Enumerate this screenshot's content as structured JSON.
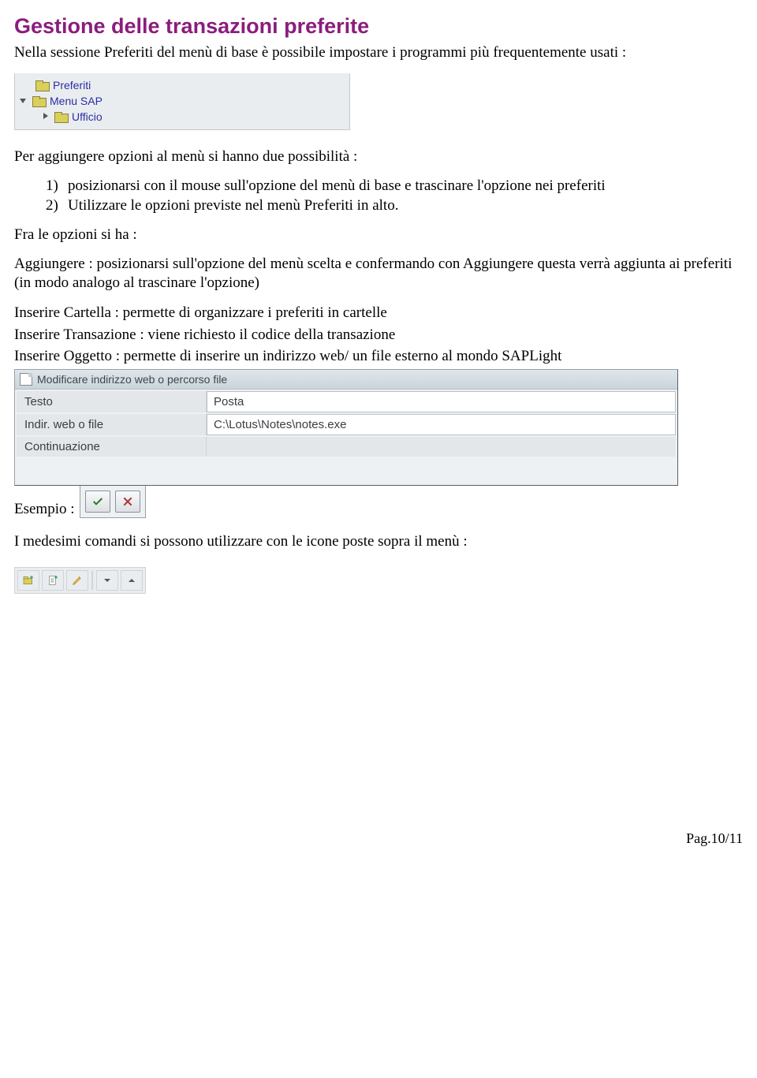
{
  "heading": "Gestione delle transazioni preferite",
  "intro": "Nella sessione Preferiti del menù di base è possibile impostare i programmi più frequentemente usati :",
  "tree": {
    "items": [
      {
        "label": "Preferiti",
        "indent": 1,
        "twisty": "none"
      },
      {
        "label": "Menu SAP",
        "indent": 1,
        "twisty": "down"
      },
      {
        "label": "Ufficio",
        "indent": 2,
        "twisty": "right"
      }
    ]
  },
  "after_tree": "Per aggiungere opzioni al menù si hanno due possibilità :",
  "list": {
    "items": [
      {
        "num": "1)",
        "text": "posizionarsi con il mouse sull'opzione del menù di base e trascinare l'opzione nei preferiti"
      },
      {
        "num": "2)",
        "text": "Utilizzare le opzioni previste nel menù Preferiti in alto."
      }
    ]
  },
  "opzioni_head": "Fra le opzioni si ha :",
  "opzioni": {
    "aggiungere": "Aggiungere : posizionarsi sull'opzione del menù scelta e confermando con Aggiungere questa verrà aggiunta ai preferiti (in modo analogo al trascinare l'opzione)",
    "cartella": "Inserire Cartella : permette di organizzare i preferiti in cartelle",
    "transazione": "Inserire Transazione : viene richiesto il codice della transazione",
    "oggetto": "Inserire Oggetto : permette di inserire un indirizzo web/ un file esterno al mondo SAPLight"
  },
  "dialog": {
    "title": "Modificare indirizzo web o percorso file",
    "rows": [
      {
        "label": "Testo",
        "value": "Posta"
      },
      {
        "label": "Indir. web o file",
        "value": "C:\\Lotus\\Notes\\notes.exe"
      },
      {
        "label": "Continuazione",
        "value": ""
      }
    ],
    "ok_icon": "check-icon",
    "cancel_icon": "cross-icon"
  },
  "esempio_label": "Esempio :",
  "after_example": "I medesimi comandi si possono utilizzare con le icone poste sopra il menù :",
  "toolbar": {
    "buttons": [
      {
        "name": "add-folder-icon"
      },
      {
        "name": "add-transaction-icon"
      },
      {
        "name": "edit-icon"
      },
      {
        "name": "move-down-icon"
      },
      {
        "name": "move-up-icon"
      }
    ]
  },
  "footer": "Pag.10/11"
}
